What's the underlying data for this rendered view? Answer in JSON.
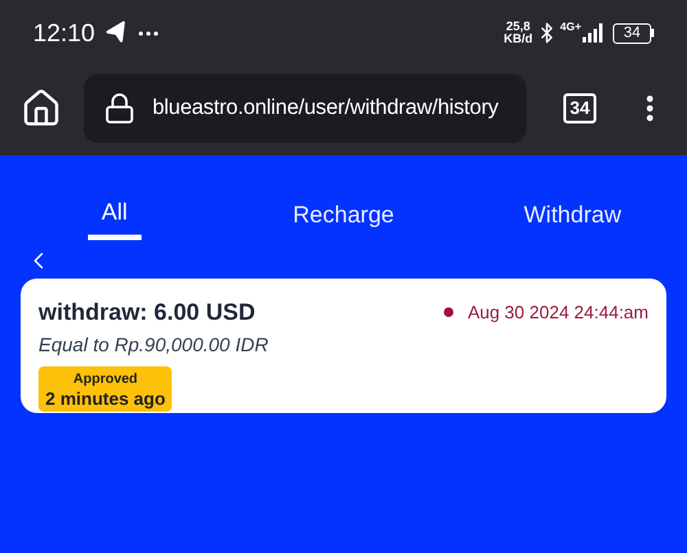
{
  "status_bar": {
    "time": "12:10",
    "speed_value": "25,8",
    "speed_unit": "KB/d",
    "network": "4G+",
    "battery": "34"
  },
  "browser": {
    "url": "blueastro.online/user/withdraw/history",
    "tab_count": "34"
  },
  "tabs": [
    {
      "label": "All",
      "selected": true
    },
    {
      "label": "Recharge",
      "selected": false
    },
    {
      "label": "Withdraw",
      "selected": false
    }
  ],
  "records": [
    {
      "title": "withdraw: 6.00 USD",
      "subtitle": "Equal to Rp.90,000.00 IDR",
      "date": "Aug 30 2024 24:44:am",
      "color": "#a0103a",
      "status": "Approved",
      "time_ago": "2 minutes ago"
    }
  ]
}
